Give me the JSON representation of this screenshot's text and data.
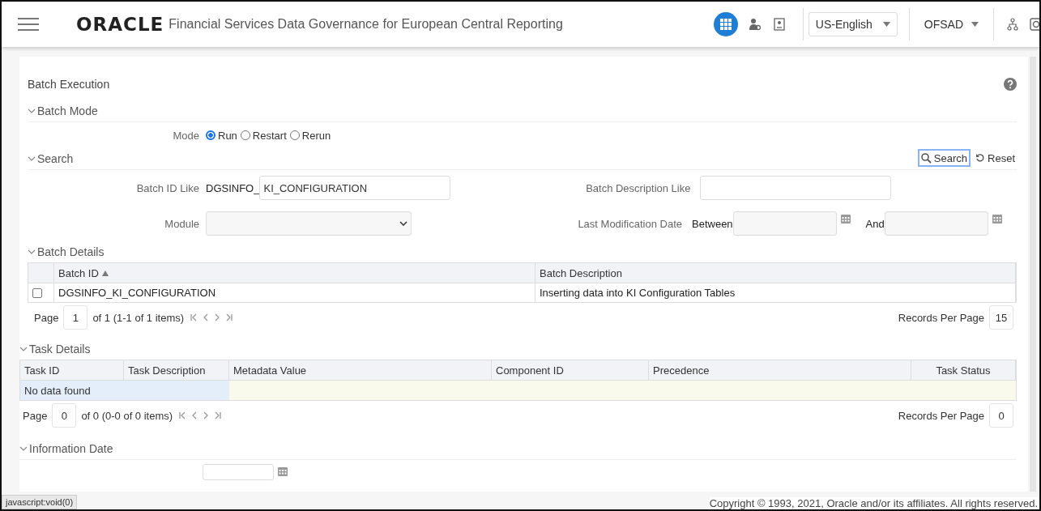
{
  "header": {
    "logo": "ORACLE",
    "app_title": "Financial Services Data Governance for European Central Reporting",
    "language": "US-English",
    "user": "OFSAD"
  },
  "page": {
    "title": "Batch Execution"
  },
  "batch_mode": {
    "title": "Batch Mode",
    "label": "Mode",
    "options": [
      {
        "label": "Run",
        "selected": true
      },
      {
        "label": "Restart",
        "selected": false
      },
      {
        "label": "Rerun",
        "selected": false
      }
    ]
  },
  "search": {
    "title": "Search",
    "search_button": "Search",
    "reset_button": "Reset",
    "batch_id_label": "Batch ID Like",
    "batch_id_prefix": "DGSINFO_",
    "batch_id_value": "KI_CONFIGURATION",
    "batch_description_label": "Batch Description Like",
    "module_label": "Module",
    "last_modification_label": "Last Modification Date",
    "between_label": "Between",
    "and_label": "And"
  },
  "batch_details": {
    "title": "Batch Details",
    "columns": [
      {
        "label": "Batch ID",
        "sorted": true
      },
      {
        "label": "Batch Description",
        "sorted": false
      }
    ],
    "rows": [
      {
        "checked": false,
        "cells": [
          "DGSINFO_KI_CONFIGURATION",
          "Inserting data into KI Configuration Tables"
        ]
      }
    ],
    "pager": {
      "page_label": "Page",
      "page": "1",
      "summary": "of 1 (1-1 of 1 items)",
      "records_label": "Records Per Page",
      "records": "15"
    }
  },
  "task_details": {
    "title": "Task Details",
    "columns": [
      "Task ID",
      "Task Description",
      "Metadata Value",
      "Component ID",
      "Precedence",
      "Task Status"
    ],
    "empty_message": "No data found",
    "pager": {
      "page_label": "Page",
      "page": "0",
      "summary": "of 0 (0-0 of 0 items)",
      "records_label": "Records Per Page",
      "records": "0"
    }
  },
  "information_date": {
    "title": "Information Date"
  },
  "status_url": "javascript:void(0)",
  "footer": "Copyright © 1993, 2021, Oracle and/or its affiliates. All rights reserved."
}
